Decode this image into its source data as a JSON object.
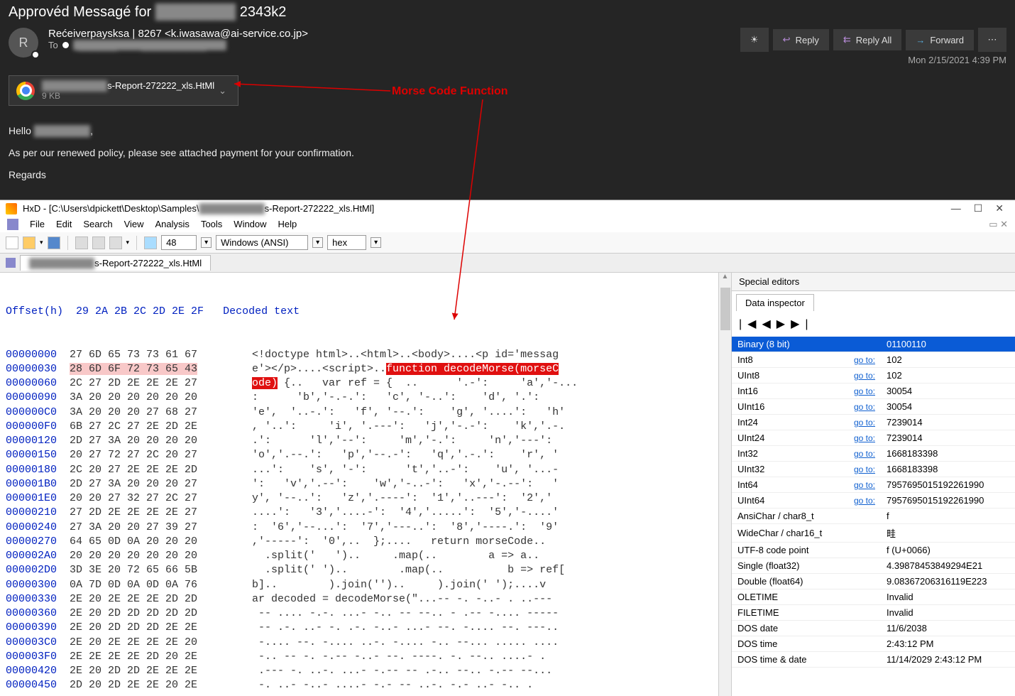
{
  "email": {
    "subject_prefix": "Approvéd Messagé for ",
    "subject_blur": "████████",
    "subject_suffix": " 2343k2",
    "avatar_initial": "R",
    "sender": "Rećeiverpaysksa | 8267  <k.iwasawa@ai-service.co.jp>",
    "to_label": "To",
    "to_blur": "a██████ey@s██████████.com",
    "timestamp": "Mon 2/15/2021 4:39 PM",
    "actions": {
      "reply": "Reply",
      "reply_all": "Reply All",
      "forward": "Forward"
    },
    "attachment": {
      "name_blur": "██████████s-Report-272222_xls.HtMl",
      "size": "9 KB"
    },
    "body_hello": "Hello ",
    "body_hello_blur": "████████",
    "body_hello_end": ",",
    "body_line2": "As per our renewed policy, please see attached payment for your confirmation.",
    "body_regards": "Regards"
  },
  "annotation": {
    "label": "Morse Code Function"
  },
  "hxd": {
    "title_prefix": "HxD - [C:\\Users\\dpickett\\Desktop\\Samples\\",
    "title_blur": "██████████",
    "title_suffix": "s-Report-272222_xls.HtMl]",
    "menus": [
      "File",
      "Edit",
      "Search",
      "View",
      "Analysis",
      "Tools",
      "Window",
      "Help"
    ],
    "toolbar": {
      "num": "48",
      "encoding": "Windows (ANSI)",
      "base": "hex"
    },
    "tab_blur": "██████████s-Report-272222_xls.HtMl",
    "hex_header_left": "Offset(h)  29 2A 2B 2C 2D 2E 2F",
    "hex_header_right": "Decoded text",
    "rows": [
      {
        "off": "00000000",
        "hex": "27 6D 65 73 73 61 67",
        "dec": "<!doctype html>..<html>..<body>....<p id='messag"
      },
      {
        "off": "00000030",
        "hex": "28 6D 6F 72 73 65 43",
        "dec": "e'></p>....<script>..",
        "hl": true,
        "fn": "function decodeMorse(morseC"
      },
      {
        "off": "00000060",
        "hex": "2C 27 2D 2E 2E 2E 27",
        "dec_pre": "ode)",
        "dec": " {..   var ref = {  ..      '.-':     'a','-..."
      },
      {
        "off": "00000090",
        "hex": "3A 20 20 20 20 20 20",
        "dec": ":      'b','-.-.':   'c', '-..':    'd', '.':"
      },
      {
        "off": "000000C0",
        "hex": "3A 20 20 20 27 68 27",
        "dec": "'e',  '..-.':   'f', '--.':    'g', '....':   'h'"
      },
      {
        "off": "000000F0",
        "hex": "6B 27 2C 27 2E 2D 2E",
        "dec": ", '..':     'i', '.---':   'j','-.-':    'k','.-."
      },
      {
        "off": "00000120",
        "hex": "2D 27 3A 20 20 20 20",
        "dec": ".':      'l','--':     'm','-.':     'n','---':"
      },
      {
        "off": "00000150",
        "hex": "20 27 72 27 2C 20 27",
        "dec": "'o','.--.':   'p','--.-':   'q','.-.':    'r', '"
      },
      {
        "off": "00000180",
        "hex": "2C 20 27 2E 2E 2E 2D",
        "dec": "...':    's', '-':      't','..-':    'u', '...-"
      },
      {
        "off": "000001B0",
        "hex": "2D 27 3A 20 20 20 27",
        "dec": "':   'v','.--':    'w','-..-':   'x','-.--':   '"
      },
      {
        "off": "000001E0",
        "hex": "20 20 27 32 27 2C 27",
        "dec": "y', '--..':   'z','.----':  '1','..---':  '2','"
      },
      {
        "off": "00000210",
        "hex": "27 2D 2E 2E 2E 2E 27",
        "dec": "....':   '3','....-':  '4','.....':  '5','-....'"
      },
      {
        "off": "00000240",
        "hex": "27 3A 20 20 27 39 27",
        "dec": ":  '6','--...':  '7','---..':  '8','----.':  '9'"
      },
      {
        "off": "00000270",
        "hex": "64 65 0D 0A 20 20 20",
        "dec": ",'-----':  '0',..  };....   return morseCode.."
      },
      {
        "off": "000002A0",
        "hex": "20 20 20 20 20 20 20",
        "dec": "  .split('   ')..     .map(..        a => a.."
      },
      {
        "off": "000002D0",
        "hex": "3D 3E 20 72 65 66 5B",
        "dec": "  .split(' ')..        .map(..          b => ref["
      },
      {
        "off": "00000300",
        "hex": "0A 7D 0D 0A 0D 0A 76",
        "dec": "b]..        ).join('')..     ).join(' ');....v"
      },
      {
        "off": "00000330",
        "hex": "2E 20 2E 2E 2E 2D 2D",
        "dec": "ar decoded = decodeMorse(\"...-- -. -..- . ..---"
      },
      {
        "off": "00000360",
        "hex": "2E 20 2D 2D 2D 2D 2D",
        "dec": " -- .... -.-. ...- -.. -- --.. - .-- -.... -----"
      },
      {
        "off": "00000390",
        "hex": "2E 20 2D 2D 2D 2E 2E",
        "dec": " -- .-. ..- -. .-. -..- ...- --. -.... --. ---.."
      },
      {
        "off": "000003C0",
        "hex": "2E 20 2E 2E 2E 2E 20",
        "dec": " -.... --. -.... ..-. -.... -.. --... ..... .... "
      },
      {
        "off": "000003F0",
        "hex": "2E 2E 2E 2E 2D 20 2E",
        "dec": " -.. -- -. -.-- -..- --. ----. -. --.. ....- ."
      },
      {
        "off": "00000420",
        "hex": "2E 20 2D 2D 2E 2E 2E",
        "dec": " .--- -. ..-. ...- -.-- -- .-.. --.. -.-- --..."
      },
      {
        "off": "00000450",
        "hex": "2D 20 2D 2E 2E 20 2E",
        "dec": " -. ..- -..- ....- -.- -- ..-. -.- ..- -.. ."
      }
    ],
    "side": {
      "title": "Special editors",
      "tab": "Data inspector",
      "items": [
        {
          "k": "Binary (8 bit)",
          "v": "01100110",
          "sel": true
        },
        {
          "k": "Int8",
          "g": "go to:",
          "v": "102"
        },
        {
          "k": "UInt8",
          "g": "go to:",
          "v": "102"
        },
        {
          "k": "Int16",
          "g": "go to:",
          "v": "30054"
        },
        {
          "k": "UInt16",
          "g": "go to:",
          "v": "30054"
        },
        {
          "k": "Int24",
          "g": "go to:",
          "v": "7239014"
        },
        {
          "k": "UInt24",
          "g": "go to:",
          "v": "7239014"
        },
        {
          "k": "Int32",
          "g": "go to:",
          "v": "1668183398"
        },
        {
          "k": "UInt32",
          "g": "go to:",
          "v": "1668183398"
        },
        {
          "k": "Int64",
          "g": "go to:",
          "v": "7957695015192261990"
        },
        {
          "k": "UInt64",
          "g": "go to:",
          "v": "7957695015192261990"
        },
        {
          "k": "AnsiChar / char8_t",
          "v": "f"
        },
        {
          "k": "WideChar / char16_t",
          "v": "畦"
        },
        {
          "k": "UTF-8 code point",
          "v": "f (U+0066)"
        },
        {
          "k": "Single (float32)",
          "v": "4.39878453849294E21"
        },
        {
          "k": "Double (float64)",
          "v": "9.08367206316119E223"
        },
        {
          "k": "OLETIME",
          "v": "Invalid"
        },
        {
          "k": "FILETIME",
          "v": "Invalid"
        },
        {
          "k": "DOS date",
          "v": "11/6/2038"
        },
        {
          "k": "DOS time",
          "v": "2:43:12 PM"
        },
        {
          "k": "DOS time & date",
          "v": "11/14/2029 2:43:12 PM"
        }
      ]
    }
  }
}
